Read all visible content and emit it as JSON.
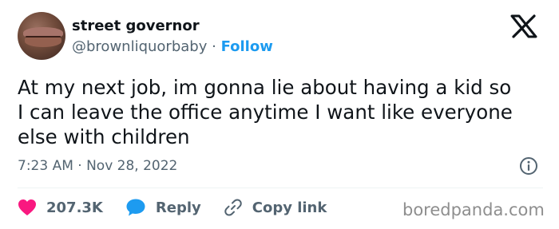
{
  "author": {
    "display_name": "street governor",
    "handle": "@brownliquorbaby",
    "separator": "·",
    "follow_label": "Follow"
  },
  "tweet": {
    "text": "At my next job, im gonna lie about having a kid so\nI can leave the office anytime I want like everyone\nelse with children",
    "timestamp": "7:23 AM · Nov 28, 2022"
  },
  "actions": {
    "likes": "207.3K",
    "reply_label": "Reply",
    "copy_link_label": "Copy link"
  },
  "watermark": "boredpanda.com",
  "icons": {
    "like": "heart-icon",
    "reply": "speech-bubble-icon",
    "copy": "link-icon",
    "info": "info-icon",
    "brand": "x-logo-icon"
  },
  "colors": {
    "like": "#f91880",
    "reply": "#1d9bf0",
    "follow": "#1d9bf0",
    "secondary_text": "#536471"
  }
}
